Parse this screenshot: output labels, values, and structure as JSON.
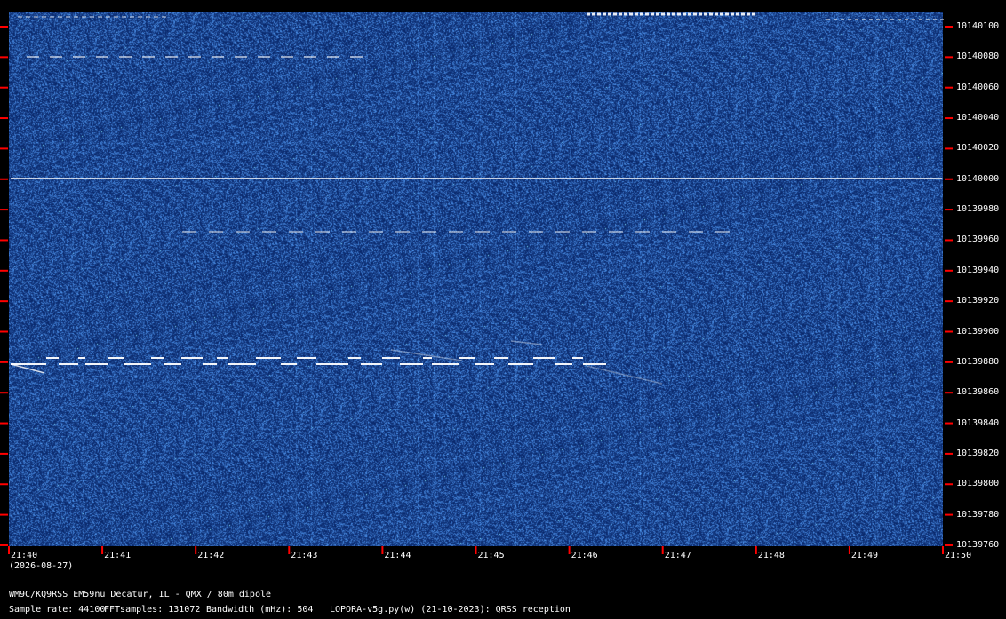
{
  "frequency_axis": {
    "labels": [
      "10140100",
      "10140080",
      "10140060",
      "10140040",
      "10140020",
      "10140000",
      "10139980",
      "10139960",
      "10139940",
      "10139920",
      "10139900",
      "10139880",
      "10139860",
      "10139840",
      "10139820",
      "10139800",
      "10139780",
      "10139760"
    ]
  },
  "time_axis": {
    "labels": [
      "21:40",
      "21:41",
      "21:42",
      "21:43",
      "21:44",
      "21:45",
      "21:46",
      "21:47",
      "21:48",
      "21:49",
      "21:50"
    ],
    "date": "(2026-08-27)"
  },
  "footer": {
    "station": "WM9C/KQ9RSS EM59nu Decatur, IL - QMX / 80m dipole",
    "sample_rate": "Sample rate: 44100",
    "fft_samples": "FFTsamples: 131072",
    "bandwidth": "Bandwidth (mHz): 504",
    "software": "LOPORA-v5g.py(w) (21-10-2023): QRSS reception"
  },
  "colors": {
    "background": "#000000",
    "waterfall": "#0b2a6e",
    "tick": "#ff0000",
    "signal": "#ffffff"
  }
}
